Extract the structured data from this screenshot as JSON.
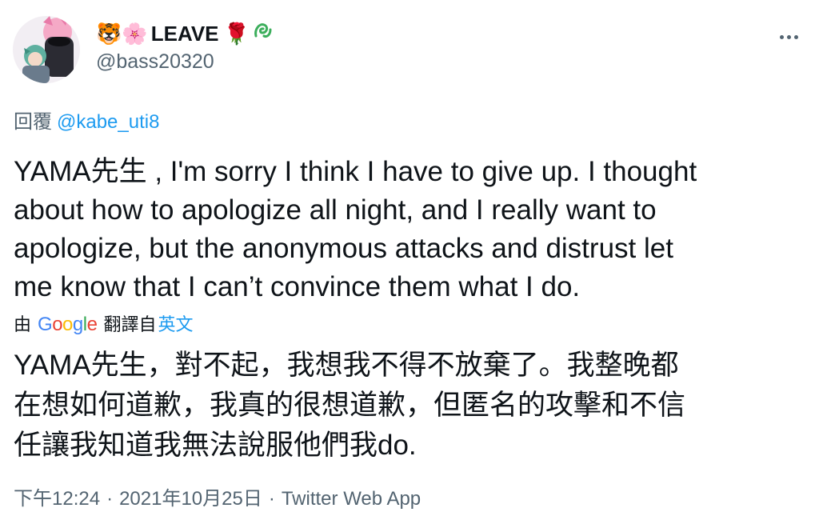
{
  "author": {
    "display_name": "LEAVE",
    "name_emoji_before": "🐯🌸",
    "name_emoji_after": "🌹",
    "handle": "@bass20320"
  },
  "reply": {
    "label": "回覆",
    "mention": "@kabe_uti8"
  },
  "tweet": {
    "text": "YAMA先生 , I'm sorry I think I have to give up. I thought\nabout how to apologize all night, and I really want to\napologize, but the anonymous attacks and distrust let\nme know that I can’t convince them what I do."
  },
  "translation": {
    "prefix": "由",
    "provider": "Google",
    "suffix": "翻譯自",
    "source_language": "英文",
    "text": "YAMA先生，對不起，我想我不得不放棄了。我整晚都\n在想如何道歉，我真的很想道歉，但匿名的攻擊和不信\n任讓我知道我無法說服他們我do."
  },
  "meta": {
    "time": "下午12:24",
    "date": "2021年10月25日",
    "separator": "·",
    "client": "Twitter Web App"
  },
  "icons": {
    "more": "more-dots-icon",
    "badge": "green-squiggle-icon"
  },
  "colors": {
    "link": "#1d9bf0",
    "secondary": "#536471",
    "text": "#0f1419"
  }
}
